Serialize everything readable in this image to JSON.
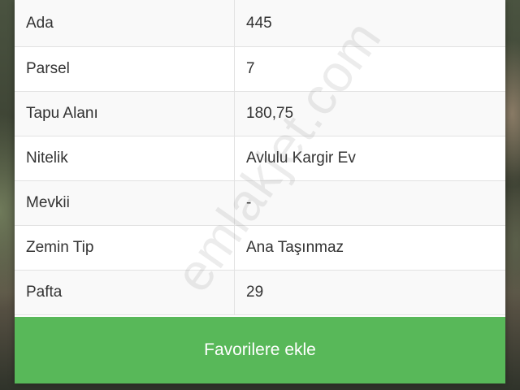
{
  "details": [
    {
      "label": "Ada",
      "value": "445"
    },
    {
      "label": "Parsel",
      "value": "7"
    },
    {
      "label": "Tapu Alanı",
      "value": "180,75"
    },
    {
      "label": "Nitelik",
      "value": "Avlulu Kargir Ev"
    },
    {
      "label": "Mevkii",
      "value": "-"
    },
    {
      "label": "Zemin Tip",
      "value": "Ana Taşınmaz"
    },
    {
      "label": "Pafta",
      "value": "29"
    }
  ],
  "favorite_button": {
    "label": "Favorilere ekle"
  },
  "watermark": {
    "text": "emlakjet.com"
  },
  "colors": {
    "button": "#58b859",
    "text": "#333333",
    "border": "#e2e2e2"
  }
}
